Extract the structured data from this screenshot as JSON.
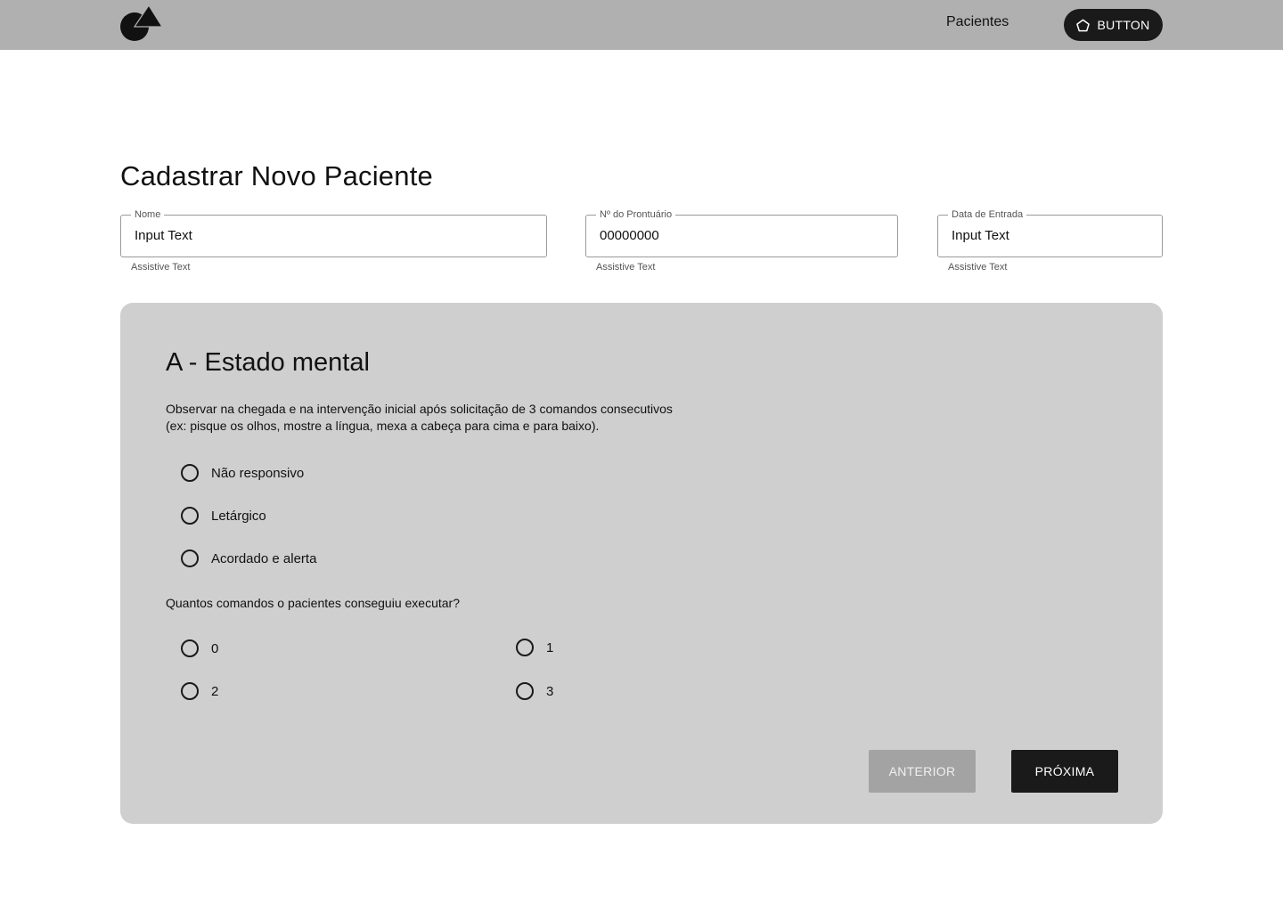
{
  "header": {
    "logo_icon": "triangle-circle-logo-icon",
    "nav_link": "Pacientes",
    "button_label": "BUTTON",
    "button_icon": "home-icon"
  },
  "page": {
    "title": "Cadastrar Novo Paciente"
  },
  "form": {
    "fields": [
      {
        "label": "Nome",
        "value": "Input Text",
        "assistive": "Assistive Text"
      },
      {
        "label": "Nº do Prontuário",
        "value": "00000000",
        "assistive": "Assistive Text"
      },
      {
        "label": "Data de Entrada",
        "value": "Input Text",
        "assistive": "Assistive Text"
      }
    ]
  },
  "section": {
    "title": "A - Estado mental",
    "description_line1": "Observar na chegada e na intervenção inicial após solicitação de 3 comandos consecutivos",
    "description_line2": "(ex: pisque os olhos, mostre a língua, mexa a cabeça para cima e para baixo).",
    "options": [
      "Não responsivo",
      "Letárgico",
      "Acordado e alerta"
    ],
    "question": "Quantos comandos o pacientes conseguiu executar?",
    "command_options": [
      "0",
      "1",
      "2",
      "3"
    ]
  },
  "actions": {
    "previous": "ANTERIOR",
    "next": "PRÓXIMA"
  },
  "colors": {
    "header_bg": "#b0b0b0",
    "card_bg": "#d0cfd0",
    "primary": "#1a1a1a",
    "disabled": "#a3a3a3"
  }
}
